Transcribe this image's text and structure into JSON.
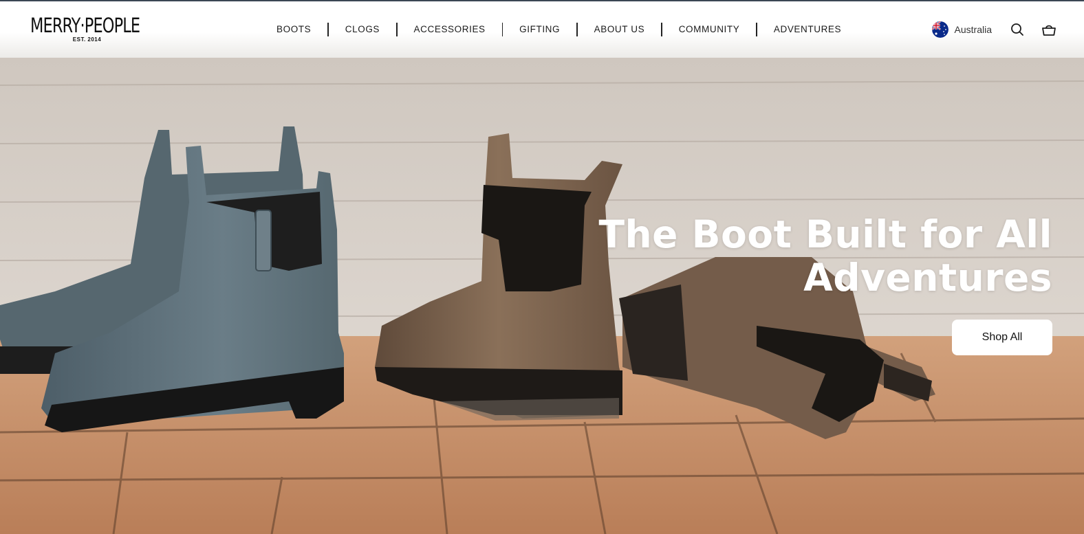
{
  "brand": {
    "name": "MERRY·PEOPLE",
    "tagline": "EST. 2014"
  },
  "nav": {
    "items": [
      {
        "label": "BOOTS"
      },
      {
        "label": "CLOGS"
      },
      {
        "label": "ACCESSORIES"
      },
      {
        "label": "GIFTING"
      },
      {
        "label": "ABOUT US"
      },
      {
        "label": "COMMUNITY"
      },
      {
        "label": "ADVENTURES"
      }
    ]
  },
  "header": {
    "locale": "Australia",
    "icons": [
      "australia-flag-icon",
      "search-icon",
      "cart-basket-icon"
    ]
  },
  "hero": {
    "title_line1": "The Boot Built for All",
    "title_line2": "Adventures",
    "cta_label": "Shop All"
  },
  "colors": {
    "top_line": "#3b4654",
    "wall": "#d6cfc8",
    "brick": "#c9946a",
    "boot_blue": "#5b6d77",
    "boot_brown": "#7b6350",
    "cta_bg": "#ffffff"
  }
}
